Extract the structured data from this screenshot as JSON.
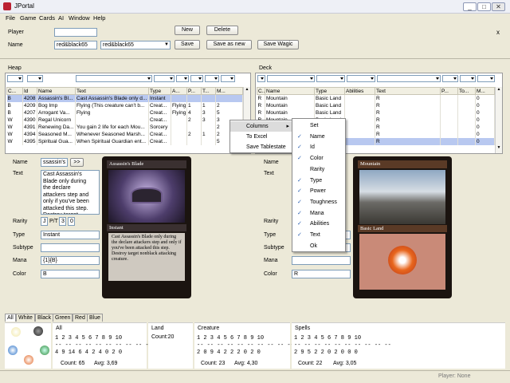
{
  "window": {
    "title": "JPortal",
    "minimize": "_",
    "maximize": "□",
    "close": "✕"
  },
  "menu": [
    "File",
    "Game",
    "Cards",
    "AI",
    "Window",
    "Help"
  ],
  "player": {
    "label": "Player",
    "name_label": "Name",
    "name_value": "red&black65",
    "deck_select": "red&black65",
    "close_x": "x"
  },
  "buttons": {
    "new": "New",
    "delete": "Delete",
    "save": "Save",
    "save_as_new": "Save as new",
    "save_wagic": "Save Wagic"
  },
  "heap": {
    "title": "Heap",
    "columns": [
      "C...",
      "Id",
      "Name",
      "Text",
      "Type",
      "A...",
      "P...",
      "T...",
      "M..."
    ],
    "rows": [
      [
        "B",
        "4208",
        "Assassin's Bl...",
        "Cast Assassin's Blade only d...",
        "Instant",
        "",
        "",
        "",
        ""
      ],
      [
        "B",
        "4209",
        "Bog Imp",
        "Flying (This creature can't b...",
        "Creat...",
        "Flying",
        "1",
        "1",
        "2"
      ],
      [
        "B",
        "4207",
        "Arrogant Va...",
        "Flying",
        "Creat...",
        "Flying",
        "4",
        "3",
        "5"
      ],
      [
        "W",
        "4390",
        "Regal Unicorn",
        "",
        "Creat...",
        "",
        "2",
        "3",
        "3"
      ],
      [
        "W",
        "4391",
        "Renewing Da...",
        "You gain 2 life for each Mou...",
        "Sorcery",
        "",
        "",
        "",
        "2"
      ],
      [
        "W",
        "4394",
        "Seasoned M...",
        "Whenever Seasoned Marsh...",
        "Creat...",
        "",
        "2",
        "1",
        "2"
      ],
      [
        "W",
        "4395",
        "Spiritual Gua...",
        "When Spiritual Guardian ent...",
        "Creat...",
        "",
        "",
        "",
        "5"
      ]
    ]
  },
  "deck": {
    "title": "Deck",
    "columns": [
      "C...",
      "Name",
      "Type",
      "Abilities",
      "Text",
      "P...",
      "To...",
      "M..."
    ],
    "rows": [
      [
        "R",
        "Mountain",
        "Basic Land",
        "",
        "R",
        "",
        "",
        "0"
      ],
      [
        "R",
        "Mountain",
        "Basic Land",
        "",
        "R",
        "",
        "",
        "0"
      ],
      [
        "R",
        "Mountain",
        "Basic Land",
        "",
        "R",
        "",
        "",
        "0"
      ],
      [
        "R",
        "Mountain",
        "Basic Land",
        "",
        "R",
        "",
        "",
        "0"
      ],
      [
        "R",
        "Mountain",
        "Basic Land",
        "",
        "R",
        "",
        "",
        "0"
      ],
      [
        "R",
        "Mountain",
        "Basic Land",
        "",
        "R",
        "",
        "",
        "0"
      ],
      [
        "R",
        "Mountain",
        "Basic Land",
        "",
        "R",
        "",
        "",
        "0"
      ]
    ]
  },
  "left_detail": {
    "name_label": "Name",
    "name_value": "ssassin's E",
    "go_btn": ">>",
    "text_label": "Text",
    "text_value": "Cast Assassin's Blade only during the declare attackers step and only if you've been attacked this step. Destroy target",
    "rarity_label": "Rarity",
    "rarity_value": "J",
    "pt_label": "P/T",
    "power": "3",
    "toughness": "0",
    "type_label": "Type",
    "type_value": "Instant",
    "subtype_label": "Subtype",
    "subtype_value": "",
    "mana_label": "Mana",
    "mana_value": "{1}{B}",
    "color_label": "Color",
    "color_value": "B"
  },
  "left_card": {
    "name": "Assassin's Blade",
    "type": "Instant",
    "rules": "Cast Assassin's Blade only during the declare attackers step and only if you've been attacked this step. Destroy target nonblack attacking creature."
  },
  "right_detail": {
    "name_label": "Name",
    "text_label": "Text",
    "rarity_label": "Rarity",
    "type_label": "Type",
    "subtype_label": "Subtype",
    "mana_label": "Mana",
    "color_label": "Color",
    "color_value": "R"
  },
  "right_card": {
    "name": "Mountain",
    "type": "Basic Land"
  },
  "context_menu": {
    "items": [
      "Columns",
      "To Excel",
      "Save Tablestate"
    ]
  },
  "columns_submenu": [
    {
      "label": "Set",
      "checked": false
    },
    {
      "label": "Name",
      "checked": true
    },
    {
      "label": "Id",
      "checked": true
    },
    {
      "label": "Color",
      "checked": true
    },
    {
      "label": "Rarity",
      "checked": false
    },
    {
      "label": "Type",
      "checked": true
    },
    {
      "label": "Power",
      "checked": true
    },
    {
      "label": "Toughness",
      "checked": true
    },
    {
      "label": "Mana",
      "checked": true
    },
    {
      "label": "Abilities",
      "checked": true
    },
    {
      "label": "Text",
      "checked": true
    },
    {
      "label": "Ok",
      "checked": false
    }
  ],
  "color_tabs": [
    "All",
    "White",
    "Black",
    "Green",
    "Red",
    "Blue"
  ],
  "stats": {
    "all": {
      "label": "All",
      "r1": "1 2 3 4 5 6 7 8 9 10",
      "r2": "-- -- -- -- -- -- -- -- -- --",
      "r3": "4 9 14 6 4 2 4 0 2 0",
      "count": "Count: 65",
      "avg": "Avg: 3,69"
    },
    "land": {
      "label": "Land",
      "count": "Count:20"
    },
    "creature": {
      "label": "Creature",
      "r1": "1 2 3 4 5 6 7 8 9 10",
      "r2": "-- -- -- -- -- -- -- -- -- --",
      "r3": "2 0 9 4 2 2 2 0 2 0",
      "count": "Count: 23",
      "avg": "Avg: 4,30"
    },
    "spells": {
      "label": "Spells",
      "r1": "1 2 3 4 5 6 7 8 9 10",
      "r2": "-- -- -- -- -- -- -- -- -- --",
      "r3": "2 9 5 2 2 0 2 0 0 0",
      "count": "Count: 22",
      "avg": "Avg: 3,05"
    }
  },
  "status": {
    "player": "Player: None"
  }
}
